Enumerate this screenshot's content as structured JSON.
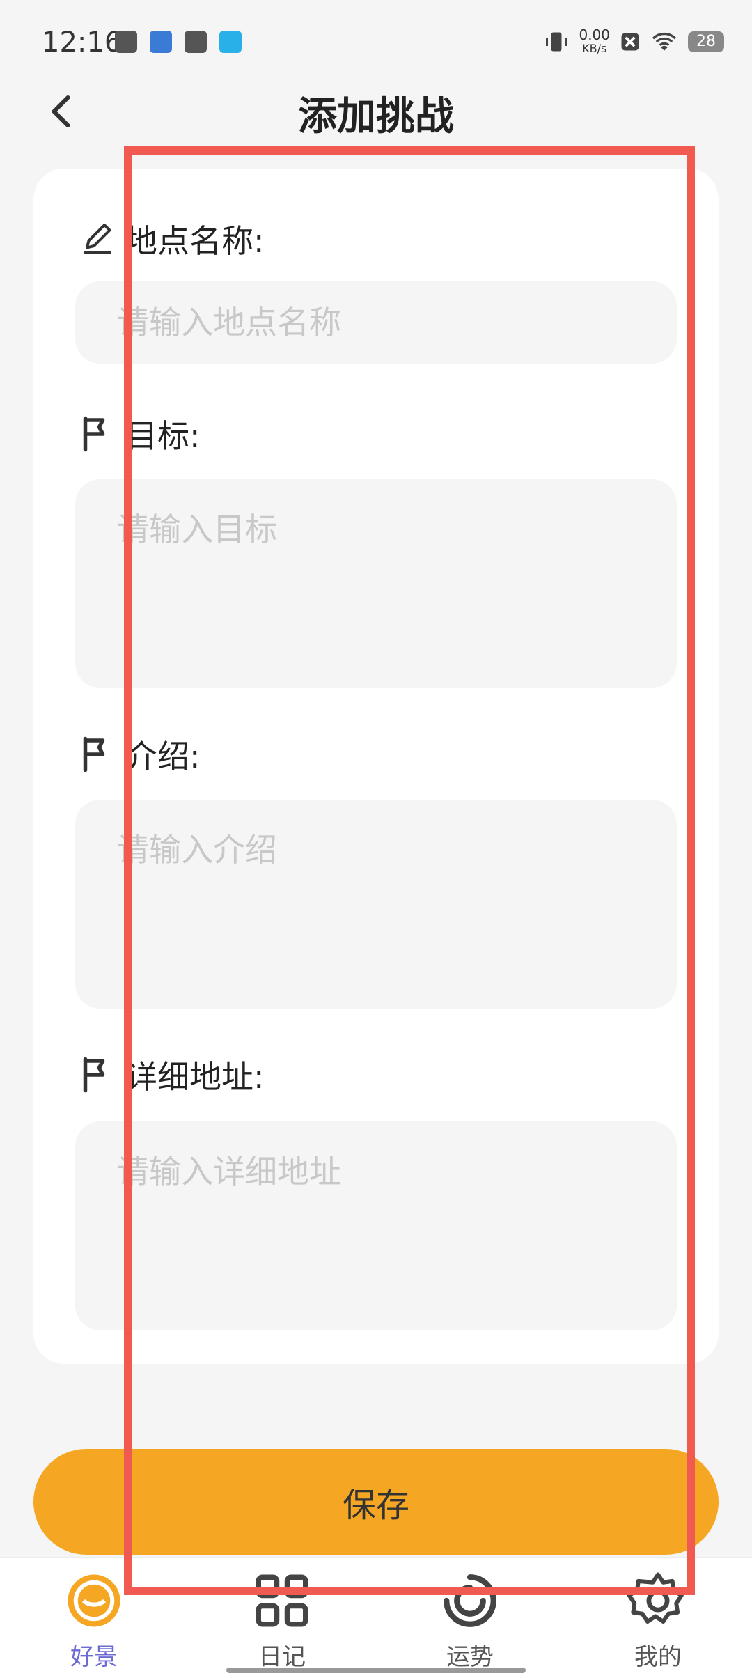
{
  "status_bar": {
    "time": "12:16",
    "net_speed": "0.00",
    "net_unit": "KB/s",
    "battery": "28"
  },
  "header": {
    "title": "添加挑战"
  },
  "form": {
    "fields": [
      {
        "label": "地点名称:",
        "placeholder": "请输入地点名称"
      },
      {
        "label": "目标:",
        "placeholder": "请输入目标"
      },
      {
        "label": "介绍:",
        "placeholder": "请输入介绍"
      },
      {
        "label": "详细地址:",
        "placeholder": "请输入详细地址"
      }
    ]
  },
  "actions": {
    "save_label": "保存"
  },
  "tabbar": {
    "items": [
      {
        "label": "好景",
        "icon": "landscape-icon",
        "active": true
      },
      {
        "label": "日记",
        "icon": "grid-icon",
        "active": false
      },
      {
        "label": "运势",
        "icon": "fortune-icon",
        "active": false
      },
      {
        "label": "我的",
        "icon": "settings-gear-icon",
        "active": false
      }
    ]
  },
  "colors": {
    "accent": "#F5A623",
    "active_tab": "#6B6BD6",
    "highlight": "#F05A50"
  }
}
